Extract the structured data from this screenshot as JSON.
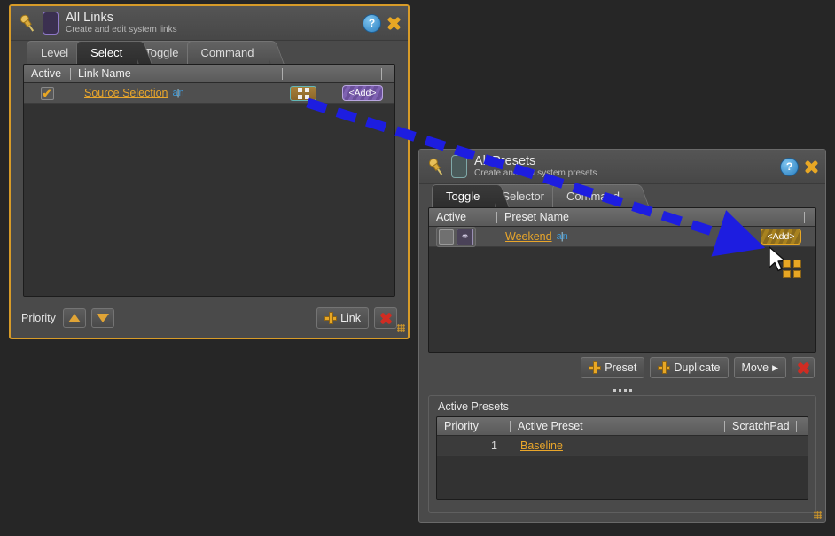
{
  "links_window": {
    "pin_icon": "pushpin-icon",
    "badge_color": "#3b3050",
    "title": "All Links",
    "subtitle": "Create and edit system links",
    "help_label": "?",
    "help_icon": "help-icon",
    "close_icon": "close-icon",
    "tabs": [
      {
        "label": "Level",
        "active": false
      },
      {
        "label": "Select",
        "active": true
      },
      {
        "label": "Toggle",
        "active": false
      },
      {
        "label": "Command",
        "active": false
      }
    ],
    "table": {
      "headers": [
        "Active",
        "Link Name"
      ],
      "rows": [
        {
          "active": true,
          "check_glyph": "✔",
          "name": "Source Selection",
          "edit_icon": "a|n",
          "grid_icon": "grid-drag-icon",
          "add_label": "<Add>"
        }
      ]
    },
    "footer": {
      "priority_label": "Priority",
      "up_icon": "arrow-up-icon",
      "down_icon": "arrow-down-icon",
      "link_label": "Link",
      "delete_icon": "delete-icon"
    }
  },
  "presets_window": {
    "pin_icon": "pushpin-icon",
    "badge_color": "#4a5a5a",
    "title": "All Presets",
    "subtitle": "Create and edit system presets",
    "help_label": "?",
    "help_icon": "help-icon",
    "close_icon": "close-icon",
    "tabs": [
      {
        "label": "Toggle",
        "active": true
      },
      {
        "label": "Selector",
        "active": false
      },
      {
        "label": "Command",
        "active": false
      }
    ],
    "table": {
      "headers": [
        "Active",
        "Preset Name"
      ],
      "rows": [
        {
          "active": false,
          "chain_glyph": "⚭",
          "name": "Weekend",
          "edit_icon": "a|n",
          "add_label": "<Add>",
          "add_highlighted": true
        }
      ]
    },
    "footer": {
      "preset_label": "Preset",
      "duplicate_label": "Duplicate",
      "move_label": "Move",
      "move_arrow": "▶",
      "delete_icon": "delete-icon"
    },
    "active_presets": {
      "panel_title": "Active Presets",
      "headers": [
        "Priority",
        "Active Preset",
        "ScratchPad"
      ],
      "rows": [
        {
          "priority": "1",
          "preset": "Baseline",
          "scratchpad": ""
        }
      ]
    }
  },
  "drag": {
    "arrow_color": "#1d1de0",
    "description": "drag-arrow",
    "cursor_icon": "mouse-pointer-icon",
    "badge_icon": "grid-drag-badge"
  }
}
